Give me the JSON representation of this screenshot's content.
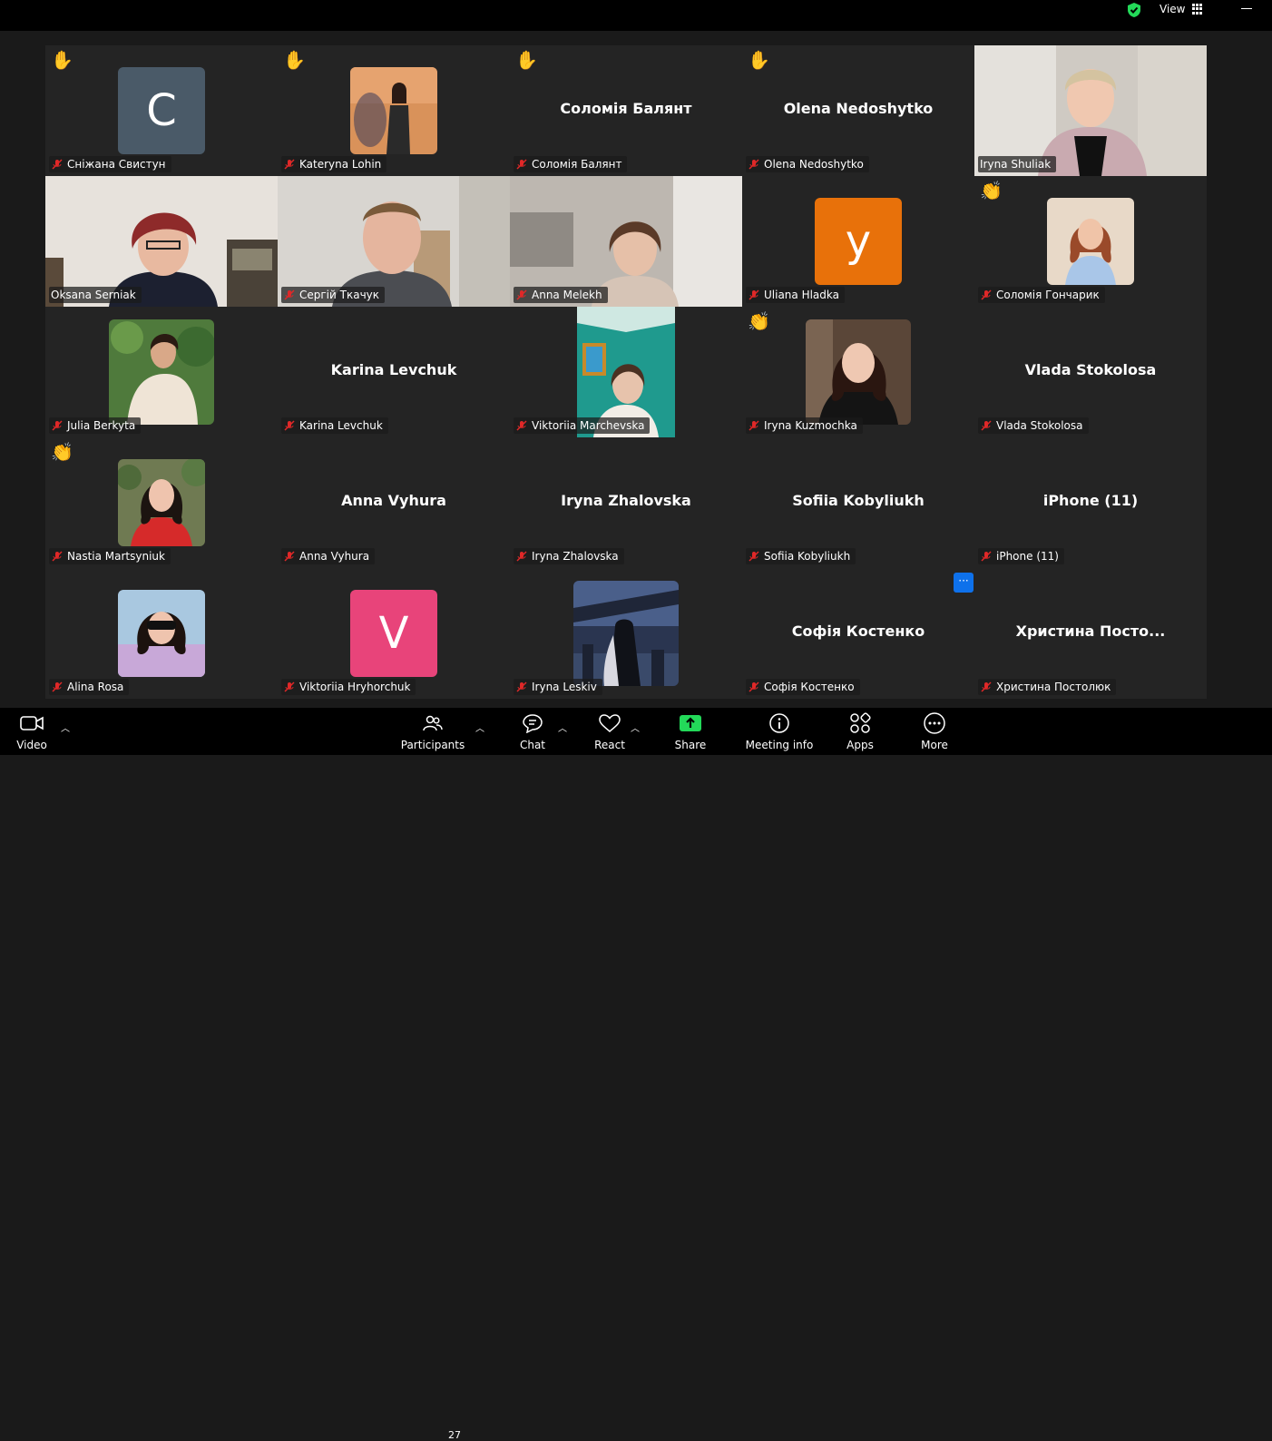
{
  "header": {
    "view_label": "View"
  },
  "tiles": [
    {
      "name": "Сніжана Свистун",
      "hand": "✋"
    },
    {
      "name": "Kateryna Lohin",
      "hand": "✋"
    },
    {
      "name": "Соломія Балянт",
      "center": "Соломія Балянт",
      "hand": "✋"
    },
    {
      "name": "Olena Nedoshytko",
      "center": "Olena Nedoshytko",
      "hand": "✋"
    },
    {
      "name": "Iryna Shuliak"
    },
    {
      "name": "Oksana Serniak"
    },
    {
      "name": "Сергій Ткачук"
    },
    {
      "name": "Anna Melekh"
    },
    {
      "name": "Uliana Hladka"
    },
    {
      "name": "Соломія Гончарик",
      "hand": "👏"
    },
    {
      "name": "Julia Berkyta"
    },
    {
      "name": "Karina Levchuk",
      "center": "Karina Levchuk"
    },
    {
      "name": "Viktoriia Marchevska"
    },
    {
      "name": "Iryna Kuzmochka",
      "hand": "👏"
    },
    {
      "name": "Vlada Stokolosa",
      "center": "Vlada Stokolosa"
    },
    {
      "name": "Nastia Martsyniuk",
      "hand": "👏"
    },
    {
      "name": "Anna Vyhura",
      "center": "Anna Vyhura"
    },
    {
      "name": "Iryna Zhalovska",
      "center": "Iryna Zhalovska"
    },
    {
      "name": "Sofiia Kobyliukh",
      "center": "Sofiia Kobyliukh"
    },
    {
      "name": "iPhone (11)",
      "center": "iPhone (11)"
    },
    {
      "name": "Alina Rosa"
    },
    {
      "name": "Viktoriia Hryhorchuk"
    },
    {
      "name": "Iryna Leskiv"
    },
    {
      "name": "Софія Костенко",
      "center": "Софія Костенко"
    },
    {
      "name": "Христина Постолюк",
      "center": "Христина  Посто..."
    }
  ],
  "avatars": {
    "snizhana": "C",
    "uliana": "y",
    "viktoriia_h": "V"
  },
  "more_dots": "···",
  "toolbar": {
    "video": "Video",
    "participants": "Participants",
    "participants_count": "27",
    "chat": "Chat",
    "react": "React",
    "share": "Share",
    "meeting_info": "Meeting info",
    "apps": "Apps",
    "more": "More"
  },
  "colors": {
    "active_speaker": "#23d959",
    "share_green": "#23d959",
    "mute_red": "#e02828",
    "blue_button": "#0e71eb",
    "avatar_c": "#4a5a68",
    "avatar_y": "#e8710a",
    "avatar_v": "#e8447a"
  }
}
